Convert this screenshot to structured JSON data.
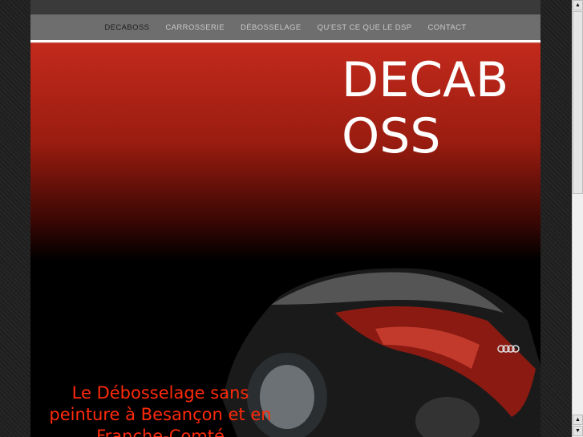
{
  "nav": {
    "items": [
      {
        "label": "DECABOSS",
        "active": true
      },
      {
        "label": "CARROSSERIE"
      },
      {
        "label": "DÉBOSSELAGE"
      },
      {
        "label": "QU'EST CE QUE LE DSP"
      },
      {
        "label": "CONTACT"
      }
    ]
  },
  "hero": {
    "title": "DECABOSS",
    "tagline": "Le Débosselage sans peinture à Besançon et en Franche-Comté"
  },
  "colors": {
    "accent": "#c22a1c",
    "tagline": "#ff2a0a",
    "nav": "#6e6e6e"
  }
}
